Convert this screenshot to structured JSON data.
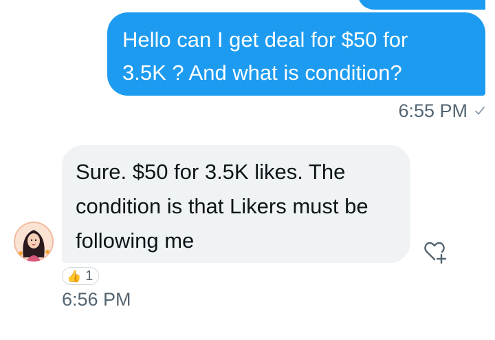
{
  "conversation": {
    "sent_message": {
      "text": "Hello can I get deal for $50 for\n3.5K ? And what is condition?",
      "time": "6:55 PM",
      "status_icon": "check-icon"
    },
    "received_message": {
      "text": "Sure. $50 for 3.5K likes. The condition is that Likers must be following me",
      "time": "6:56 PM",
      "reaction": {
        "emoji": "👍",
        "count": "1"
      },
      "add_reaction_icon": "heart-plus-icon"
    }
  },
  "colors": {
    "sent_bubble": "#1d9bf0",
    "received_bubble": "#eff3f4",
    "meta_text": "#536471"
  }
}
